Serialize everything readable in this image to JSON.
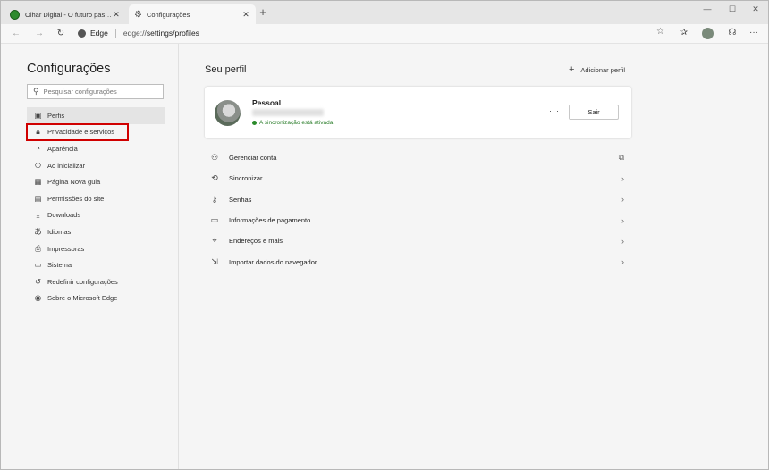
{
  "tabs": [
    {
      "title": "Olhar Digital - O futuro passa primeiro aqui",
      "favicon_color": "#2e8b2e",
      "active": false
    },
    {
      "title": "Configurações",
      "favicon_icon": "gear-icon",
      "active": true
    }
  ],
  "toolbar": {
    "site_label": "Edge",
    "url_prefix": "edge://",
    "url_path": "settings/profiles"
  },
  "sidebar": {
    "title": "Configurações",
    "search_placeholder": "Pesquisar configurações",
    "items": [
      {
        "label": "Perfis",
        "icon": "profile-card-icon",
        "selected": true
      },
      {
        "label": "Privacidade e serviços",
        "icon": "lock-icon",
        "highlighted": true
      },
      {
        "label": "Aparência",
        "icon": "palette-icon"
      },
      {
        "label": "Ao inicializar",
        "icon": "power-icon"
      },
      {
        "label": "Página Nova guia",
        "icon": "grid-icon"
      },
      {
        "label": "Permissões do site",
        "icon": "site-permissions-icon"
      },
      {
        "label": "Downloads",
        "icon": "download-icon"
      },
      {
        "label": "Idiomas",
        "icon": "language-icon"
      },
      {
        "label": "Impressoras",
        "icon": "printer-icon"
      },
      {
        "label": "Sistema",
        "icon": "system-icon"
      },
      {
        "label": "Redefinir configurações",
        "icon": "reset-icon"
      },
      {
        "label": "Sobre o Microsoft Edge",
        "icon": "edge-icon"
      }
    ]
  },
  "main": {
    "title": "Seu perfil",
    "add_profile_label": "Adicionar perfil",
    "profile": {
      "name": "Pessoal",
      "sync_status": "A sincronização está ativada",
      "more_label": "···",
      "signout_label": "Sair"
    },
    "rows": [
      {
        "label": "Gerenciar conta",
        "icon": "person-icon",
        "trailing": "external-link-icon"
      },
      {
        "label": "Sincronizar",
        "icon": "sync-icon",
        "trailing": "chevron-right-icon"
      },
      {
        "label": "Senhas",
        "icon": "key-icon",
        "trailing": "chevron-right-icon"
      },
      {
        "label": "Informações de pagamento",
        "icon": "credit-card-icon",
        "trailing": "chevron-right-icon"
      },
      {
        "label": "Endereços e mais",
        "icon": "location-pin-icon",
        "trailing": "chevron-right-icon"
      },
      {
        "label": "Importar dados do navegador",
        "icon": "import-icon",
        "trailing": "chevron-right-icon"
      }
    ]
  },
  "colors": {
    "highlight_border": "#d00000",
    "sync_green": "#2a7d2a"
  }
}
